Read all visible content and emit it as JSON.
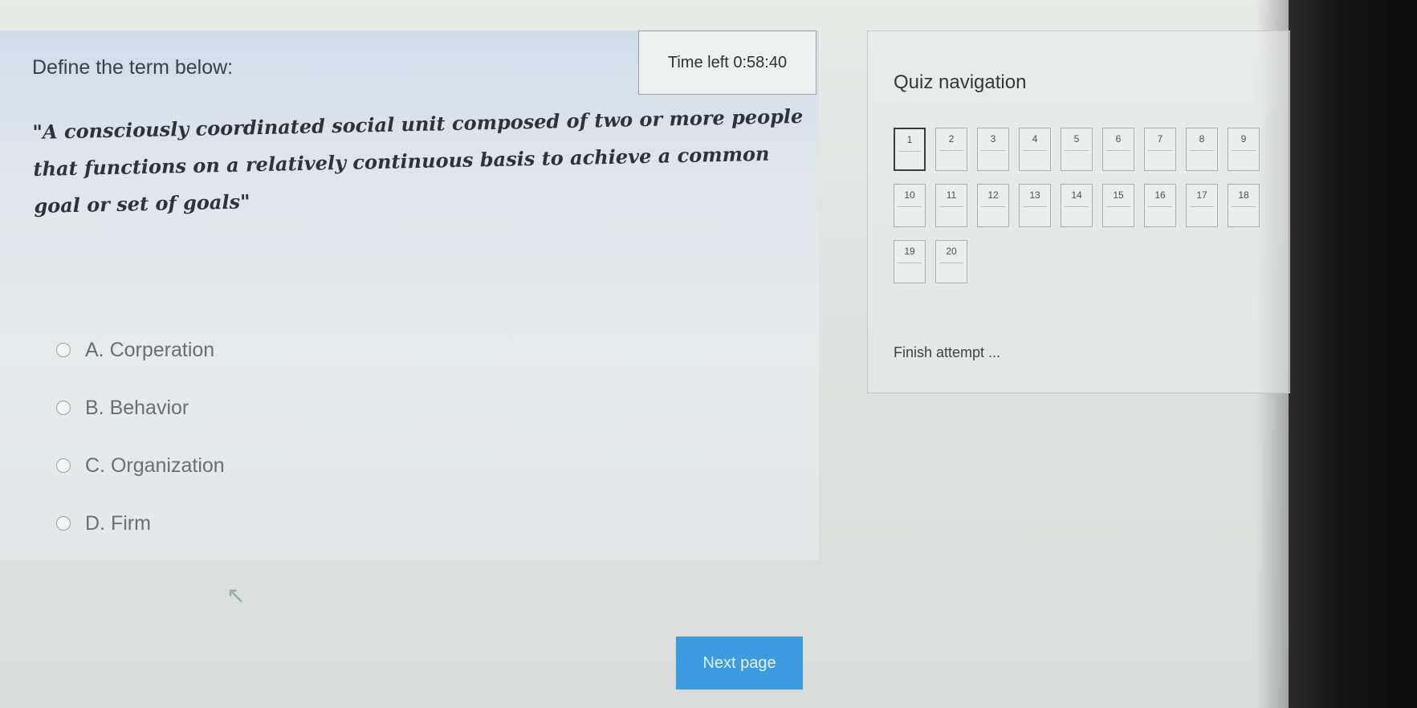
{
  "question": {
    "prompt": "Define the term below:",
    "definition": "\"A consciously coordinated social unit composed of two or more people that functions on a relatively continuous basis to achieve a common goal or set of goals\"",
    "timer": "Time left 0:58:40",
    "answers": [
      "A. Corperation",
      "B. Behavior",
      "C. Organization",
      "D. Firm"
    ],
    "next_label": "Next page"
  },
  "nav": {
    "title": "Quiz navigation",
    "buttons": [
      "1",
      "2",
      "3",
      "4",
      "5",
      "6",
      "7",
      "8",
      "9",
      "10",
      "11",
      "12",
      "13",
      "14",
      "15",
      "16",
      "17",
      "18",
      "19",
      "20"
    ],
    "current": "1",
    "finish_label": "Finish attempt ..."
  },
  "colors": {
    "accent": "#3d9be0",
    "bezel": "#141414"
  }
}
